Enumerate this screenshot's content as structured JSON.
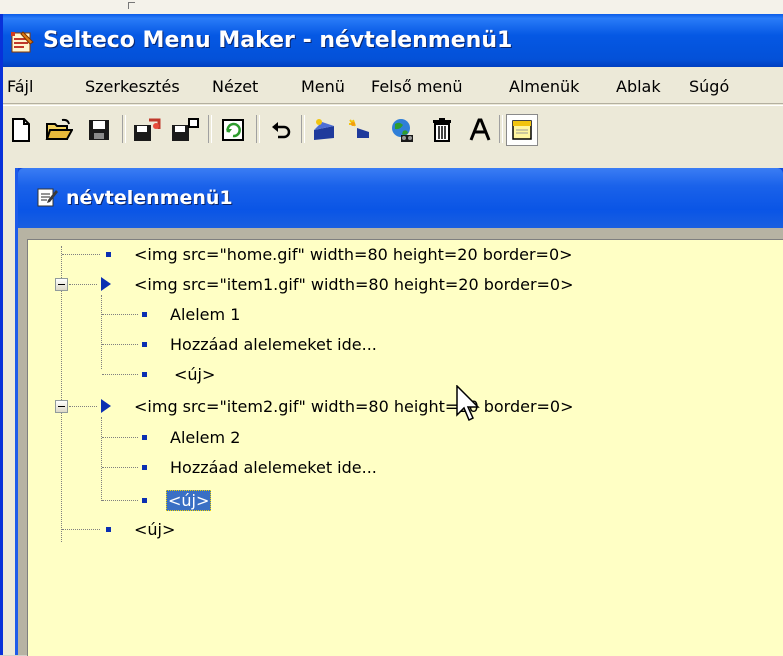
{
  "app": {
    "title": "Selteco Menu Maker - névtelenmenü1",
    "accent": "#0558e4",
    "tree_background": "#ffffc5",
    "selection_color": "#3a6fc4"
  },
  "menubar": [
    "Fájl",
    "Szerkesztés",
    "Nézet",
    "Menü",
    "Felső menü",
    "Almenük",
    "Ablak",
    "Súgó"
  ],
  "toolbar": [
    {
      "icon": "new-file-icon"
    },
    {
      "icon": "open-folder-icon"
    },
    {
      "icon": "save-disk-icon"
    },
    {
      "icon": "export-icon"
    },
    {
      "icon": "publish-icon"
    },
    {
      "icon": "refresh-icon"
    },
    {
      "icon": "undo-icon"
    },
    {
      "icon": "add-item-icon"
    },
    {
      "icon": "add-subitem-icon"
    },
    {
      "icon": "web-icon"
    },
    {
      "icon": "delete-icon"
    },
    {
      "icon": "font-icon"
    },
    {
      "icon": "note-icon"
    }
  ],
  "document": {
    "title": "névtelenmenü1"
  },
  "tree": [
    {
      "label": "<img src=\"home.gif\" width=80 height=20 border=0>",
      "level": 0,
      "type": "item"
    },
    {
      "label": "<img src=\"item1.gif\" width=80 height=20 border=0>",
      "level": 0,
      "type": "parent",
      "expanded": true
    },
    {
      "label": "Alelem 1",
      "level": 1,
      "type": "item"
    },
    {
      "label": "Hozzáad alelemeket ide...",
      "level": 1,
      "type": "item"
    },
    {
      "label": "<új>",
      "level": 1,
      "type": "item"
    },
    {
      "label": "<img src=\"item2.gif\" width=80 height=20 border=0>",
      "level": 0,
      "type": "parent",
      "expanded": true
    },
    {
      "label": "Alelem 2",
      "level": 1,
      "type": "item"
    },
    {
      "label": "Hozzáad alelemeket ide...",
      "level": 1,
      "type": "item"
    },
    {
      "label": "<új>",
      "level": 1,
      "type": "item",
      "selected": true
    },
    {
      "label": "<új>",
      "level": 0,
      "type": "item"
    }
  ]
}
